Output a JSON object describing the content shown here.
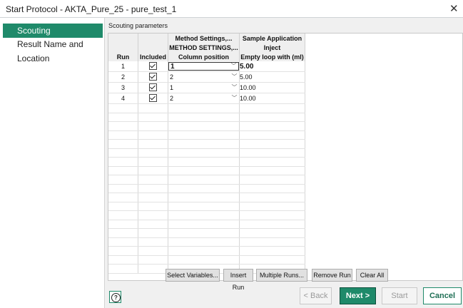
{
  "window": {
    "title": "Start Protocol - AKTA_Pure_25 - pure_test_1"
  },
  "sidebar": {
    "items": [
      {
        "label": "Scouting",
        "active": true
      },
      {
        "label": "Result Name and Location",
        "active": false
      }
    ]
  },
  "main": {
    "section_label": "Scouting parameters",
    "table": {
      "group_headers": {
        "method": "Method Settings,...",
        "sample": "Sample Application"
      },
      "sub_headers": {
        "method": "METHOD SETTINGS,...",
        "sample": "Inject"
      },
      "columns": {
        "run": "Run",
        "included": "Included",
        "column_position": "Column position",
        "empty_loop": "Empty loop with (ml)"
      },
      "rows": [
        {
          "run": "1",
          "included": true,
          "column_position": "1",
          "empty_loop": "5.00",
          "selected": true
        },
        {
          "run": "2",
          "included": true,
          "column_position": "2",
          "empty_loop": "5.00",
          "selected": false
        },
        {
          "run": "3",
          "included": true,
          "column_position": "1",
          "empty_loop": "10.00",
          "selected": false
        },
        {
          "run": "4",
          "included": true,
          "column_position": "2",
          "empty_loop": "10.00",
          "selected": false
        }
      ]
    },
    "buttons": {
      "select_variables": "Select Variables...",
      "insert_run": "Insert Run",
      "multiple_runs": "Multiple Runs...",
      "remove_run": "Remove Run",
      "clear_all": "Clear All"
    }
  },
  "footer": {
    "help_icon": "?",
    "back": "< Back",
    "next": "Next >",
    "start": "Start",
    "cancel": "Cancel"
  },
  "colors": {
    "accent": "#1f8a6a"
  }
}
